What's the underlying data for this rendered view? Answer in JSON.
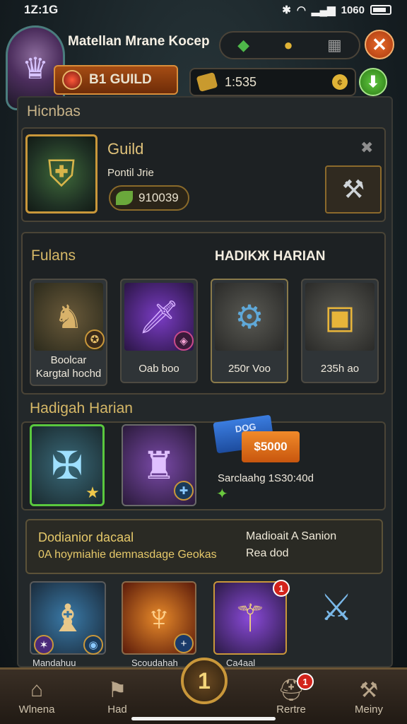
{
  "status_bar": {
    "time": "1Z:1G",
    "signal_text": "1060"
  },
  "header": {
    "player_name": "Matellan Mrane Kocep",
    "guild_label": "B1 GUILD",
    "resource_value": "1:535",
    "close_glyph": "✕",
    "add_glyph": "⬇",
    "currency_icons": [
      "green-gem-icon",
      "gold-coin-icon",
      "grid-icon"
    ]
  },
  "guild_section": {
    "heading": "Hicnbas",
    "title": "Guild",
    "subtitle": "Pontil Jrie",
    "points": "910039"
  },
  "rewards_section": {
    "heading_left": "Fulans",
    "heading_right": "HADIKЖ HARIAN",
    "items": [
      {
        "label_line1": "Boolcar",
        "label_line2": "Kargtal hochd",
        "icon": "hero-portrait"
      },
      {
        "label_line1": "Oab boo",
        "label_line2": "",
        "icon": "purple-dagger"
      },
      {
        "label_line1": "250r Voo",
        "label_line2": "",
        "icon": "gear-amulet"
      },
      {
        "label_line1": "235h ao",
        "label_line2": "",
        "icon": "gold-chest"
      }
    ]
  },
  "daily_section": {
    "heading": "Hadigah Harian",
    "ticket_blue_text": "DOG",
    "ticket_orange_text": "$5000",
    "countdown_text": "Sarclaahg 1S30:40d"
  },
  "info_box": {
    "left_title": "Dodianior dacaal",
    "left_body": "0A hoymiahie demnasdage Geokas",
    "right_title": "Madioait A Sanion",
    "right_body": "Rea dod"
  },
  "bottom_rewards": {
    "items": [
      {
        "label": "Mandahuu",
        "icon": "elf-hero"
      },
      {
        "label": "Scoudahah",
        "icon": "flame-armor"
      },
      {
        "label": "Ca4aal",
        "icon": "purple-staff",
        "badge": "1"
      },
      {
        "label": "",
        "icon": "ice-scepter"
      }
    ]
  },
  "bottom_nav": {
    "items": [
      {
        "label": "Wlnena",
        "icon": "home-icon"
      },
      {
        "label": "Had",
        "icon": "flag-icon"
      },
      {
        "label": "Rertre",
        "icon": "helmet-icon",
        "badge": "1"
      },
      {
        "label": "Meiny",
        "icon": "axe-icon"
      }
    ],
    "center_label": "1"
  },
  "colors": {
    "accent_gold": "#d6b867",
    "guild_orange": "#a54c14",
    "add_green": "#5fc83e",
    "close_orange": "#e86b2a"
  }
}
